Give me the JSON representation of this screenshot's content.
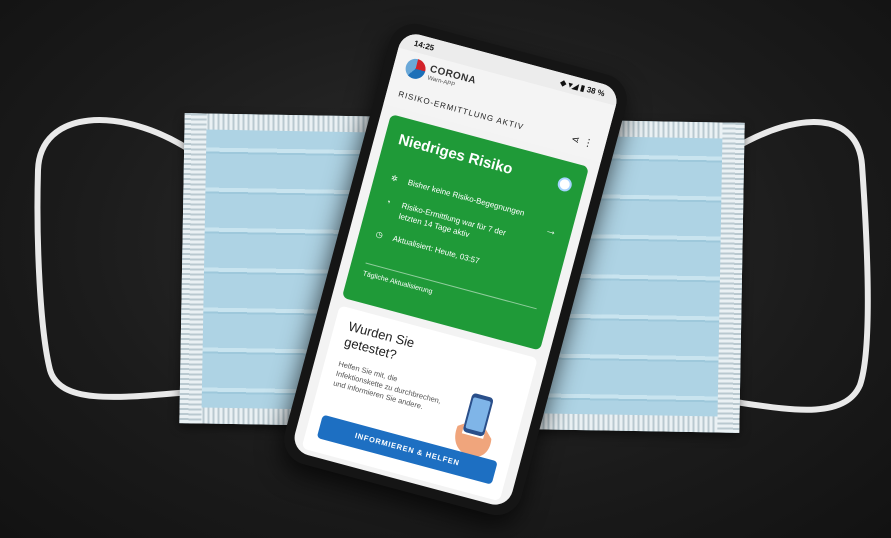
{
  "status_bar": {
    "time": "14:25",
    "icons": "◆ ▾◢ ▮ 38 %"
  },
  "app": {
    "brand_line1": "CORONA",
    "brand_line2": "Warn-APP",
    "subtitle": "RISIKO-ERMITTLUNG AKTIV"
  },
  "risk_card": {
    "title": "Niedriges Risiko",
    "item1": "Bisher keine Risiko-Begegnungen",
    "item2_line1": "Risiko-Ermittlung war für 7 der",
    "item2_line2": "letzten 14 Tage aktiv",
    "item3": "Aktualisiert: Heute, 03:57",
    "footer": "Tägliche Aktualisierung",
    "color": "#1f9a38"
  },
  "test_card": {
    "question_line1": "Wurden Sie",
    "question_line2": "getestet?",
    "description": "Helfen Sie mit, die Infektionskette zu durchbrechen, und informieren Sie andere.",
    "button_label": "INFORMIEREN & HELFEN",
    "button_color": "#1d6fc2"
  },
  "icons": [
    "virus-icon",
    "progress-circle-icon",
    "clock-icon",
    "share-icon",
    "more-vert-icon",
    "arrow-right-icon",
    "hand-phone-illustration"
  ]
}
